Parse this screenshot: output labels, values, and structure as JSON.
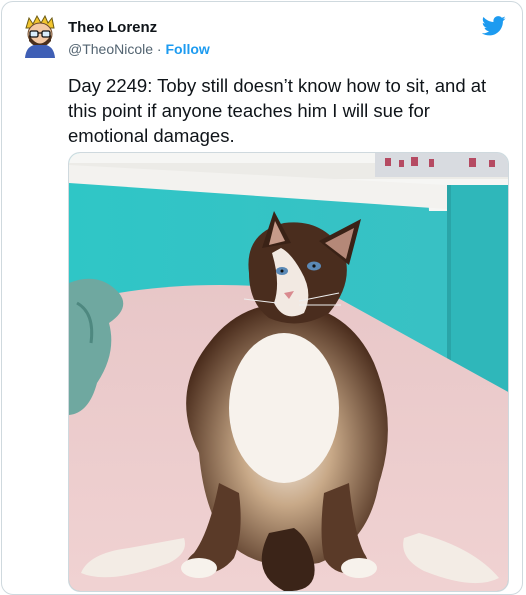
{
  "tweet": {
    "author_name": "Theo Lorenz",
    "author_handle": "@TheoNicole",
    "separator": " · ",
    "follow_label": "Follow",
    "text": "Day 2249: Toby still doesn’t know how to sit, and at this point if anyone teaches him I will sue for emotional damages."
  },
  "icons": {
    "brand": "twitter-bird-icon",
    "avatar": "cartoon-avatar"
  },
  "colors": {
    "link": "#1d9bf0",
    "name": "#0f1419",
    "handle": "#536471",
    "border": "#cfd9de"
  }
}
